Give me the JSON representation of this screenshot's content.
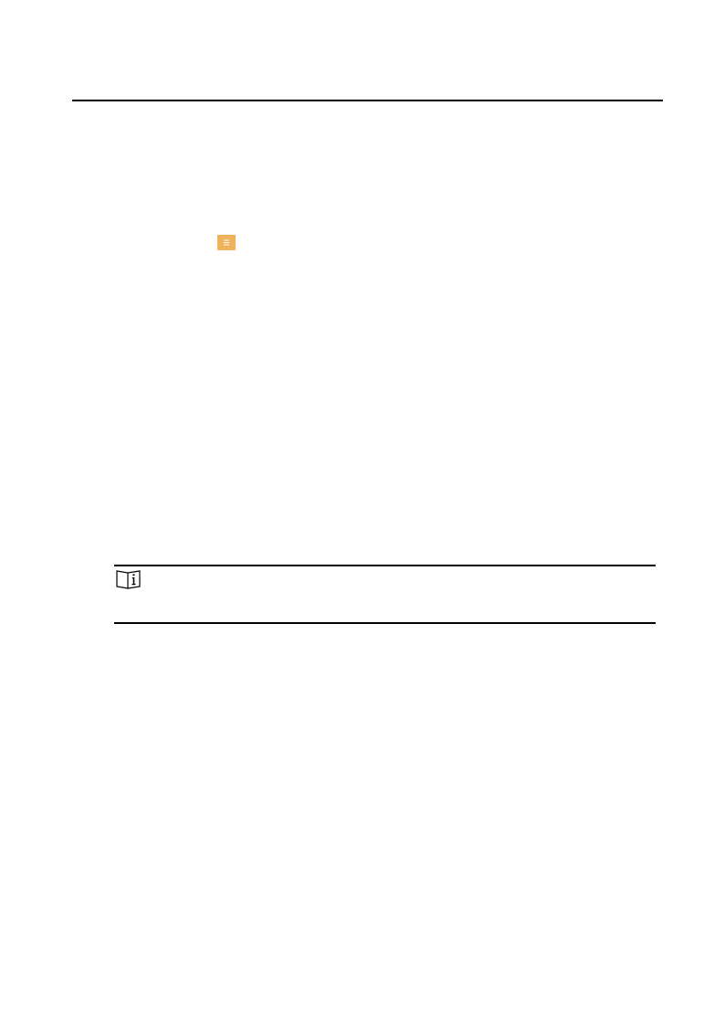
{
  "page": {
    "background": "#ffffff"
  },
  "inline_icon": {
    "name": "menu-icon",
    "color": "#f0b25a"
  },
  "note_box": {
    "icon_name": "note-book-info-icon",
    "rule_color": "#000000"
  }
}
